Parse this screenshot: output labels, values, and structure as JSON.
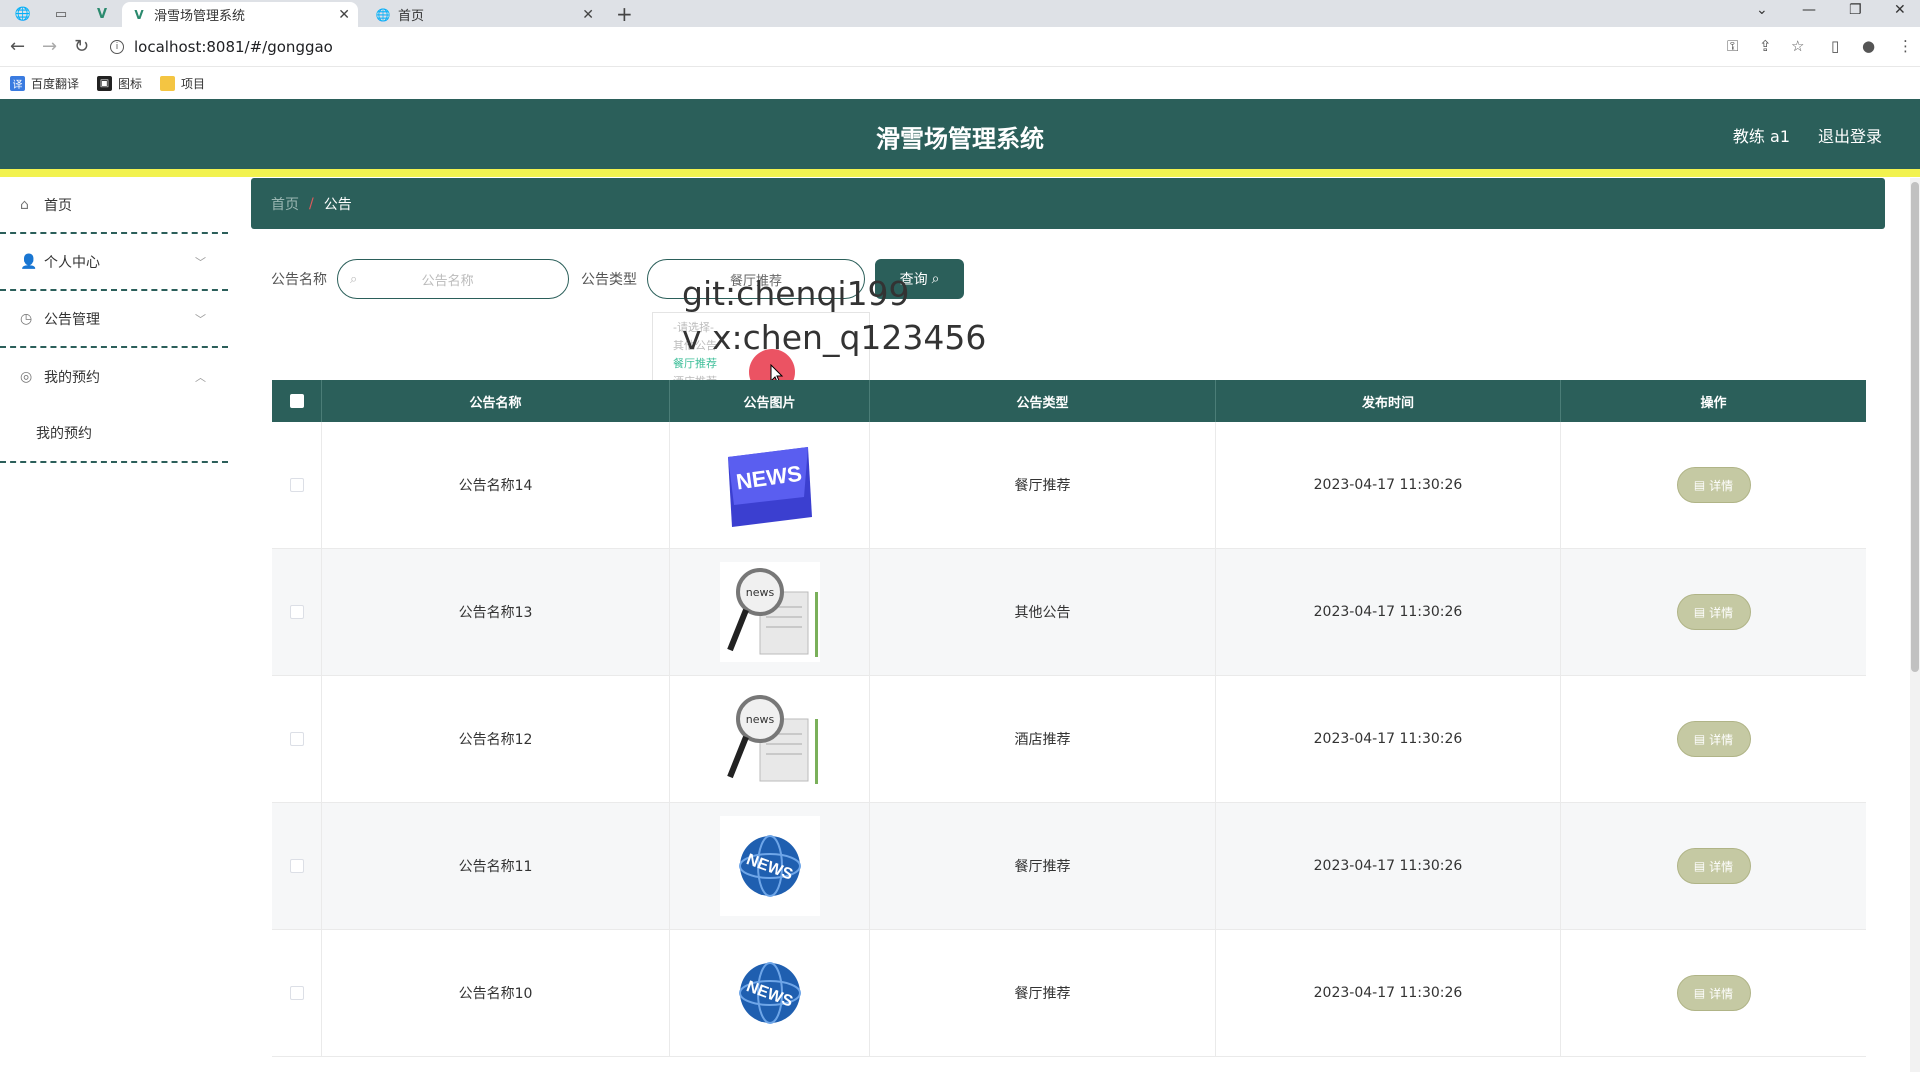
{
  "browser": {
    "tabs": [
      {
        "title": "滑雪场管理系统",
        "active": true
      },
      {
        "title": "首页",
        "active": false
      }
    ],
    "url": "localhost:8081/#/gonggao",
    "bookmarks": [
      "百度翻译",
      "图标",
      "项目"
    ]
  },
  "header": {
    "title": "滑雪场管理系统",
    "user": "教练 a1",
    "logout": "退出登录"
  },
  "sidebar": {
    "items": [
      {
        "label": "首页",
        "icon": "home-icon"
      },
      {
        "label": "个人中心",
        "icon": "user-icon"
      },
      {
        "label": "公告管理",
        "icon": "clock-icon"
      },
      {
        "label": "我的预约",
        "icon": "compass-icon"
      }
    ],
    "submenu": "我的预约"
  },
  "breadcrumb": {
    "home": "首页",
    "current": "公告"
  },
  "search": {
    "name_label": "公告名称",
    "name_placeholder": "公告名称",
    "type_label": "公告类型",
    "type_value": "餐厅推荐",
    "query_button": "查询"
  },
  "dropdown": {
    "options": [
      "-请选择-",
      "其他公告",
      "餐厅推荐",
      "酒店推荐"
    ],
    "highlighted": "餐厅推荐"
  },
  "overlay": {
    "line1": "git:chenqi199",
    "line2": "v x:chen_q123456"
  },
  "table": {
    "headers": [
      "公告名称",
      "公告图片",
      "公告类型",
      "发布时间",
      "操作"
    ],
    "rows": [
      {
        "name": "公告名称14",
        "image": "news-keyboard",
        "type": "餐厅推荐",
        "time": "2023-04-17 11:30:26",
        "action": "详情"
      },
      {
        "name": "公告名称13",
        "image": "news-magnifier",
        "type": "其他公告",
        "time": "2023-04-17 11:30:26",
        "action": "详情"
      },
      {
        "name": "公告名称12",
        "image": "news-magnifier",
        "type": "酒店推荐",
        "time": "2023-04-17 11:30:26",
        "action": "详情"
      },
      {
        "name": "公告名称11",
        "image": "news-globe",
        "type": "餐厅推荐",
        "time": "2023-04-17 11:30:26",
        "action": "详情"
      },
      {
        "name": "公告名称10",
        "image": "news-globe",
        "type": "餐厅推荐",
        "time": "2023-04-17 11:30:26",
        "action": "详情"
      }
    ]
  },
  "colors": {
    "primary": "#2b5f5a",
    "accent_bar": "#f2f24f",
    "detail_button": "#c5c9a3"
  }
}
